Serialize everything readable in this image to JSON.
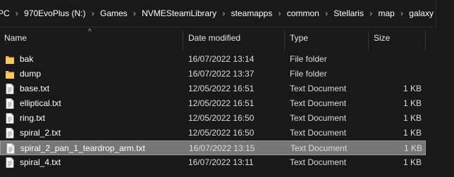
{
  "breadcrumb": {
    "items": [
      "PC",
      "970EvoPlus (N:)",
      "Games",
      "NVMESteamLibrary",
      "steamapps",
      "common",
      "Stellaris",
      "map",
      "galaxy"
    ],
    "separator": "›"
  },
  "columns": {
    "name": "Name",
    "date": "Date modified",
    "type": "Type",
    "size": "Size",
    "sort_indicator": "^"
  },
  "files": [
    {
      "name": "bak",
      "date": "16/07/2022 13:14",
      "type": "File folder",
      "size": "",
      "icon": "folder-icon"
    },
    {
      "name": "dump",
      "date": "16/07/2022 13:37",
      "type": "File folder",
      "size": "",
      "icon": "folder-icon"
    },
    {
      "name": "base.txt",
      "date": "12/05/2022 16:51",
      "type": "Text Document",
      "size": "1 KB",
      "icon": "text-file-icon"
    },
    {
      "name": "elliptical.txt",
      "date": "12/05/2022 16:51",
      "type": "Text Document",
      "size": "1 KB",
      "icon": "text-file-icon"
    },
    {
      "name": "ring.txt",
      "date": "12/05/2022 16:50",
      "type": "Text Document",
      "size": "1 KB",
      "icon": "text-file-icon"
    },
    {
      "name": "spiral_2.txt",
      "date": "12/05/2022 16:50",
      "type": "Text Document",
      "size": "1 KB",
      "icon": "text-file-icon"
    },
    {
      "name": "spiral_2_pan_1_teardrop_arm.txt",
      "date": "16/07/2022 13:15",
      "type": "Text Document",
      "size": "1 KB",
      "icon": "text-file-icon",
      "selected": true
    },
    {
      "name": "spiral_4.txt",
      "date": "16/07/2022 13:11",
      "type": "Text Document",
      "size": "1 KB",
      "icon": "text-file-icon"
    }
  ],
  "colors": {
    "background": "#191919",
    "selection": "#777777",
    "folder": "#e8b64a"
  }
}
